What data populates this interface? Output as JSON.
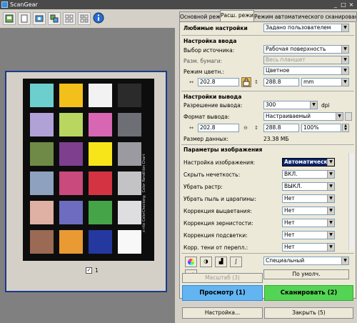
{
  "window": {
    "title": "ScanGear",
    "controls": [
      "_",
      "□",
      "×"
    ]
  },
  "toolbar": {
    "icons": [
      "page-icon",
      "blank-icon",
      "preview-icon",
      "multi-preview-icon",
      "grid-a-icon",
      "grid-b-icon",
      "info-icon"
    ]
  },
  "preview": {
    "chart_label": "x-rite ColorChecker® Color Rendition Chart",
    "frame_number": "1",
    "swatch_colors": [
      [
        "#6dcfcd",
        "#f3c01b",
        "#f2f2f2",
        "#2b2b2b"
      ],
      [
        "#b0a2d6",
        "#b8d660",
        "#d867b3",
        "#6e6e76"
      ],
      [
        "#6e8a46",
        "#7e3f8e",
        "#f7e51a",
        "#9a9aa0"
      ],
      [
        "#8ea2c0",
        "#c94a7c",
        "#d43441",
        "#c3c3c6"
      ],
      [
        "#dfb0a4",
        "#6e6cc0",
        "#46a448",
        "#dedee0"
      ],
      [
        "#9a6a54",
        "#ea9a32",
        "#2438a0",
        "#f8f8f8"
      ]
    ]
  },
  "tabs": [
    "Основной режим",
    "Расш. режим",
    "Режим автоматического сканирования"
  ],
  "favorites": {
    "label": "Любимые настройки",
    "value": "Задано пользователем"
  },
  "input": {
    "heading": "Настройка ввода",
    "source_label": "Выбор источника:",
    "source_value": "Рабочая поверхность",
    "paper_label": "Разм. бумаги:",
    "paper_value": "Весь планшет",
    "color_label": "Режим цветн.:",
    "color_value": "Цветное",
    "width": "202.8",
    "height": "288.8",
    "unit": "mm"
  },
  "output": {
    "heading": "Настройки вывода",
    "resolution_label": "Разрешение вывода:",
    "resolution_value": "300",
    "resolution_unit": "dpi",
    "format_label": "Формат вывода:",
    "format_value": "Настраиваемый",
    "width": "202.8",
    "height": "288.8",
    "scale": "100%",
    "size_label": "Размер данных:",
    "size_value": "23.38 МБ"
  },
  "image": {
    "heading": "Параметры изображения",
    "rows": [
      {
        "label": "Настройка изображения:",
        "value": "Автоматически"
      },
      {
        "label": "Скрыть нечеткость:",
        "value": "ВКЛ."
      },
      {
        "label": "Убрать растр:",
        "value": "ВЫКЛ."
      },
      {
        "label": "Убрать пыль и царапины:",
        "value": "Нет"
      },
      {
        "label": "Коррекция выцветания:",
        "value": "Нет"
      },
      {
        "label": "Коррекция зернистости:",
        "value": "Нет"
      },
      {
        "label": "Коррекция подсветки:",
        "value": "Нет"
      },
      {
        "label": "Корр. тени от перепл.:",
        "value": "Нет"
      }
    ]
  },
  "tone": {
    "preset_value": "Специальный",
    "defaults_label": "По умолч."
  },
  "actions": {
    "scale_label": "Масштаб (3)",
    "preview_label": "Просмотр (1)",
    "scan_label": "Сканировать (2)",
    "preferences_label": "Настройка...",
    "close_label": "Закрыть (5)"
  },
  "colors": {
    "preview_blue": "#63b5f2",
    "scan_green": "#54d454",
    "title_bg": "#4a4a4a",
    "frame_border": "#1a3a8a"
  }
}
